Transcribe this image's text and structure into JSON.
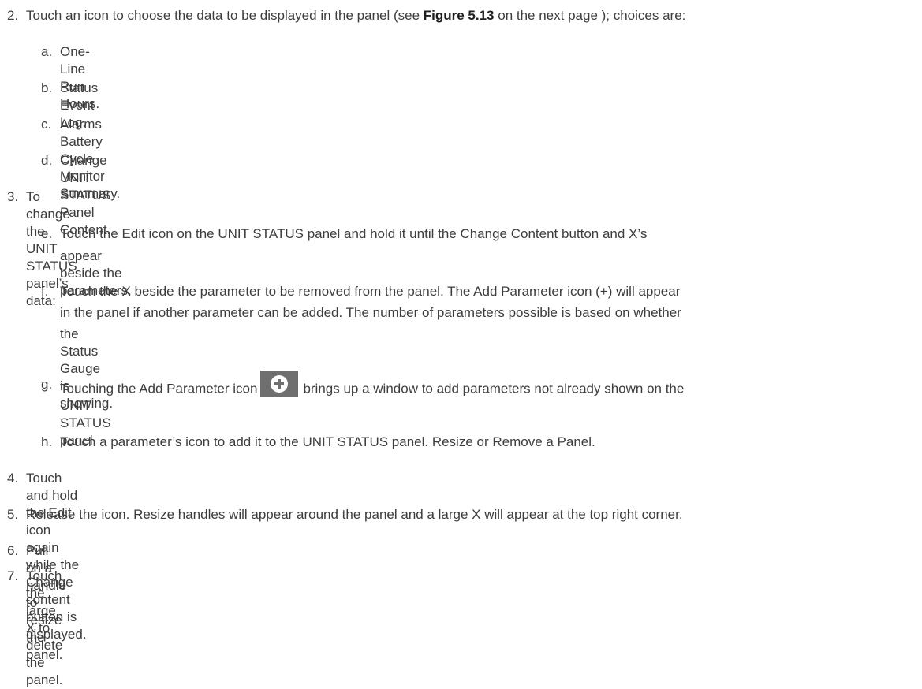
{
  "steps": [
    {
      "num": "2.",
      "pre": "Touch an icon to choose the data to be displayed in the panel (see ",
      "ref": "Figure 5.13",
      "post": "  on the next page ); choices are:"
    },
    {
      "num": "3.",
      "text": "To change the UNIT STATUS panel’s data:"
    },
    {
      "num": "4.",
      "text": "Touch and hold the Edit icon again while the Change content button is displayed."
    },
    {
      "num": "5.",
      "text": "Release the icon. Resize handles will appear around the panel and a large X will appear at the top right corner."
    },
    {
      "num": "6.",
      "text": "Pull on a handle to resize the panel."
    },
    {
      "num": "7.",
      "text": "Touch the large X to delete the panel."
    }
  ],
  "substeps": [
    {
      "num": "a.",
      "text": "One-Line Run Hours."
    },
    {
      "num": "b.",
      "text": "Status Event Log."
    },
    {
      "num": "c.",
      "text": "Alarms Battery Cycle Monitor Summary."
    },
    {
      "num": "d.",
      "text": "Change UNIT STATUS Panel Content."
    },
    {
      "num": "e.",
      "line1": "Touch the Edit icon on the UNIT STATUS panel and hold it until the Change Content button and X’s",
      "line2": "appear beside the parameters."
    },
    {
      "num": "f.",
      "line1": "Touch the X beside the parameter to be removed from the panel. The Add Parameter icon (+) will appear",
      "line2": "in the panel if another parameter can be added. The number of parameters possible is based on whether",
      "line3": "the Status Gauge is showing."
    },
    {
      "num": "g.",
      "pre": "Touching the Add Parameter icon",
      "post": "brings up a window to add parameters not already shown on the",
      "line2": "UNIT STATUS panel."
    },
    {
      "num": "h.",
      "text": "Touch a parameter’s icon to add it to the UNIT STATUS panel. Resize or Remove a Panel."
    }
  ],
  "icons": {
    "add_parameter": "plus-circle-icon"
  }
}
